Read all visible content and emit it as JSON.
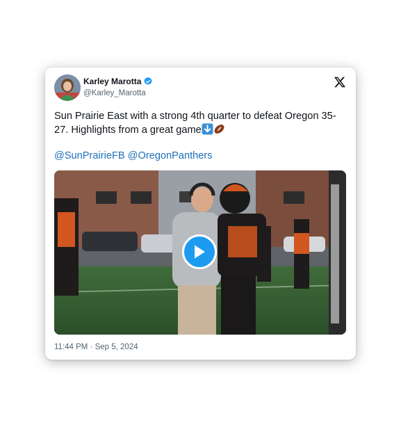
{
  "tweet": {
    "author_name": "Karley Marotta",
    "author_handle": "@Karley_Marotta",
    "text": "Sun Prairie East with a strong 4th quarter to defeat Oregon 35-27. Highlights from a great game",
    "emojis": [
      "down-arrow-emoji",
      "football-emoji"
    ],
    "mentions": [
      "@SunPrairieFB",
      "@OregonPanthers"
    ],
    "timestamp": "11:44 PM · Sep 5, 2024"
  },
  "icons": {
    "verified": "verified-badge-icon",
    "platform": "x-logo-icon",
    "play": "play-icon"
  },
  "colors": {
    "link": "#1d6fba",
    "verified": "#1d9bf0",
    "play_button": "#1d9bf0",
    "secondary_text": "#536471"
  }
}
